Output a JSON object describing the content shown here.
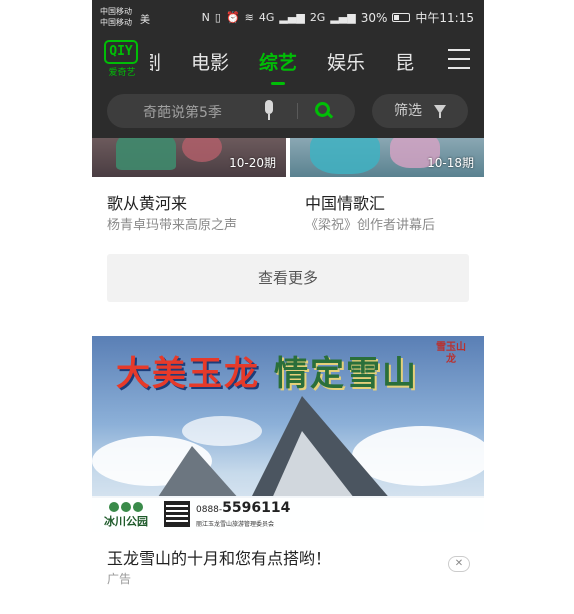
{
  "status_bar": {
    "carrier_1": "中国移动",
    "carrier_2": "中国移动",
    "carrier_extra": "美",
    "network_1": "4G",
    "network_2": "2G",
    "battery": "30%",
    "time": "中午11:15"
  },
  "nav": {
    "logo_mark": "QIY",
    "logo_text": "爱奇艺",
    "tabs": [
      {
        "label": "剧",
        "active": false
      },
      {
        "label": "电影",
        "active": false
      },
      {
        "label": "综艺",
        "active": true
      },
      {
        "label": "娱乐",
        "active": false
      },
      {
        "label": "昆",
        "active": false
      }
    ]
  },
  "search": {
    "placeholder": "奇葩说第5季",
    "filter_label": "筛选"
  },
  "cards": [
    {
      "episodes": "10-20期",
      "title": "歌从黄河来",
      "subtitle": "杨青卓玛带来高原之声"
    },
    {
      "episodes": "10-18期",
      "title": "中国情歌汇",
      "subtitle": "《梁祝》创作者讲幕后"
    }
  ],
  "more_label": "查看更多",
  "ad": {
    "headline_1": "大美玉龙",
    "headline_2": "情定雪山",
    "badge": "雪玉山龙",
    "park_name": "冰川公园",
    "phone_prefix": "0888-",
    "phone": "5596114",
    "org": "丽江玉龙雪山旅游管理委员会",
    "title": "玉龙雪山的十月和您有点搭哟！",
    "label": "广告",
    "close": "✕"
  },
  "colors": {
    "accent": "#00be06",
    "header_bg": "#2c2c2c"
  }
}
